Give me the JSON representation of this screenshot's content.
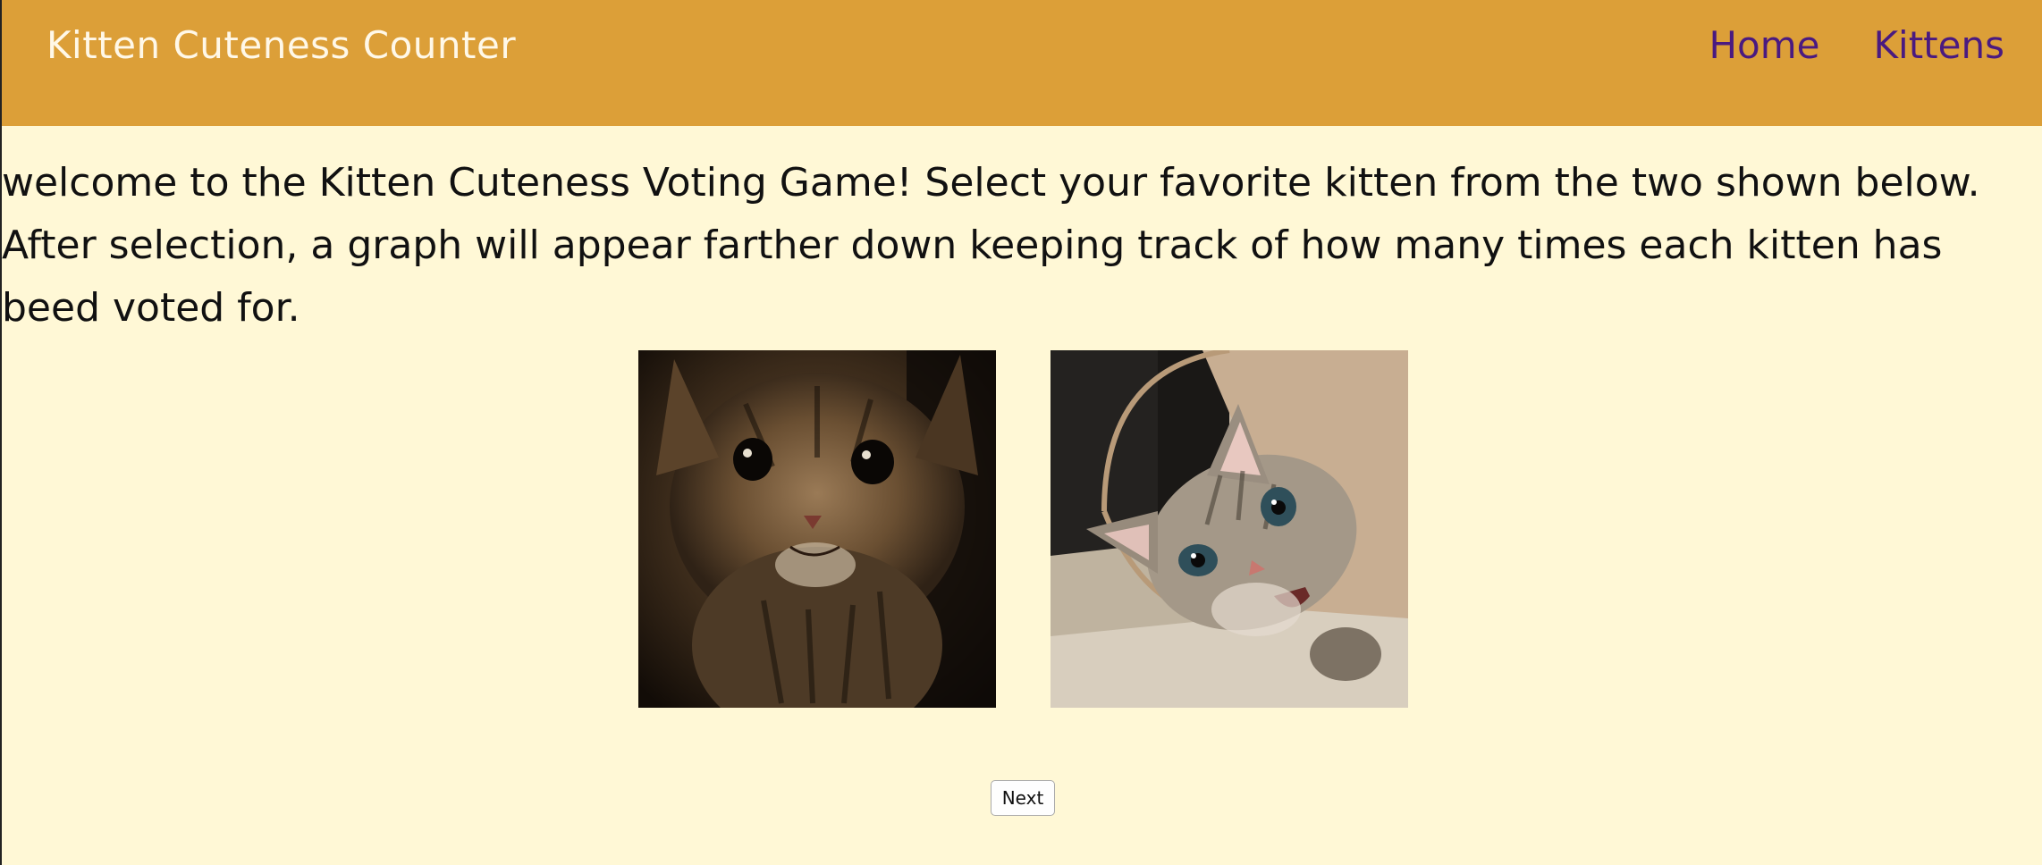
{
  "header": {
    "title": "Kitten Cuteness Counter",
    "background": "#dc9f38",
    "nav": [
      {
        "label": "Home"
      },
      {
        "label": "Kittens"
      }
    ]
  },
  "main": {
    "intro": "welcome to the Kitten Cuteness Voting Game! Select your favorite kitten from the two shown below. After selection, a graph will appear farther down keeping track of how many times each kitten has beed voted for.",
    "images": [
      {
        "name": "kitten-photo-1"
      },
      {
        "name": "kitten-photo-2"
      }
    ],
    "next_label": "Next"
  }
}
